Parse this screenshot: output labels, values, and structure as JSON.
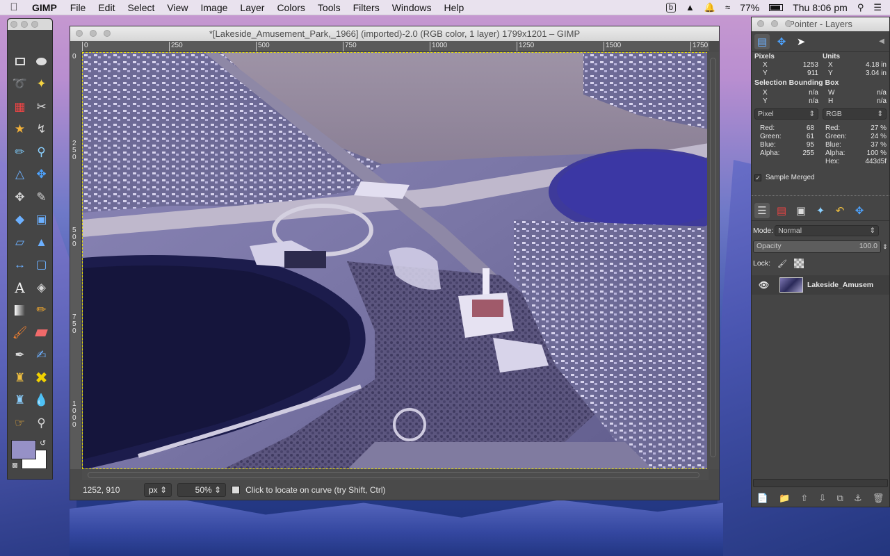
{
  "menubar": {
    "app_name": "GIMP",
    "menus": [
      "File",
      "Edit",
      "Select",
      "View",
      "Image",
      "Layer",
      "Colors",
      "Tools",
      "Filters",
      "Windows",
      "Help"
    ],
    "battery": "77%",
    "clock": "Thu 8:06 pm"
  },
  "image_window": {
    "title": "*[Lakeside_Amusement_Park,_1966] (imported)-2.0 (RGB color, 1 layer) 1799x1201 – GIMP",
    "ruler_h": [
      "0",
      "250",
      "500",
      "750",
      "1000",
      "1250",
      "1500",
      "1750"
    ],
    "ruler_v": [
      "0",
      "250",
      "500",
      "750",
      "1000"
    ],
    "status": {
      "coords": "1252, 910",
      "unit": "px",
      "zoom": "50%",
      "message": "Click to locate on curve (try Shift, Ctrl)"
    }
  },
  "dock": {
    "title": "Pointer - Layers",
    "pointer": {
      "pixels_label": "Pixels",
      "units_label": "Units",
      "x_label": "X",
      "y_label": "Y",
      "x_px": "1253",
      "y_px": "911",
      "x_units": "4.18 in",
      "y_units": "3.04 in",
      "sel_label": "Selection Bounding Box",
      "sel_x_label": "X",
      "sel_y_label": "Y",
      "sel_w_label": "W",
      "sel_h_label": "H",
      "sel_x": "n/a",
      "sel_y": "n/a",
      "sel_w": "n/a",
      "sel_h": "n/a",
      "mode_left": "Pixel",
      "mode_right": "RGB",
      "left_vals": [
        {
          "k": "Red:",
          "v": "68"
        },
        {
          "k": "Green:",
          "v": "61"
        },
        {
          "k": "Blue:",
          "v": "95"
        },
        {
          "k": "Alpha:",
          "v": "255"
        }
      ],
      "right_vals": [
        {
          "k": "Red:",
          "v": "27 %"
        },
        {
          "k": "Green:",
          "v": "24 %"
        },
        {
          "k": "Blue:",
          "v": "37 %"
        },
        {
          "k": "Alpha:",
          "v": "100 %"
        },
        {
          "k": "Hex:",
          "v": "443d5f"
        }
      ],
      "sample_merged": "Sample Merged"
    },
    "layers": {
      "mode_label": "Mode:",
      "mode_value": "Normal",
      "opacity_label": "Opacity",
      "opacity_value": "100.0",
      "lock_label": "Lock:",
      "layer_name": "Lakeside_Amusem"
    }
  },
  "colors": {
    "foreground": "#9691c7",
    "background": "#ffffff"
  }
}
